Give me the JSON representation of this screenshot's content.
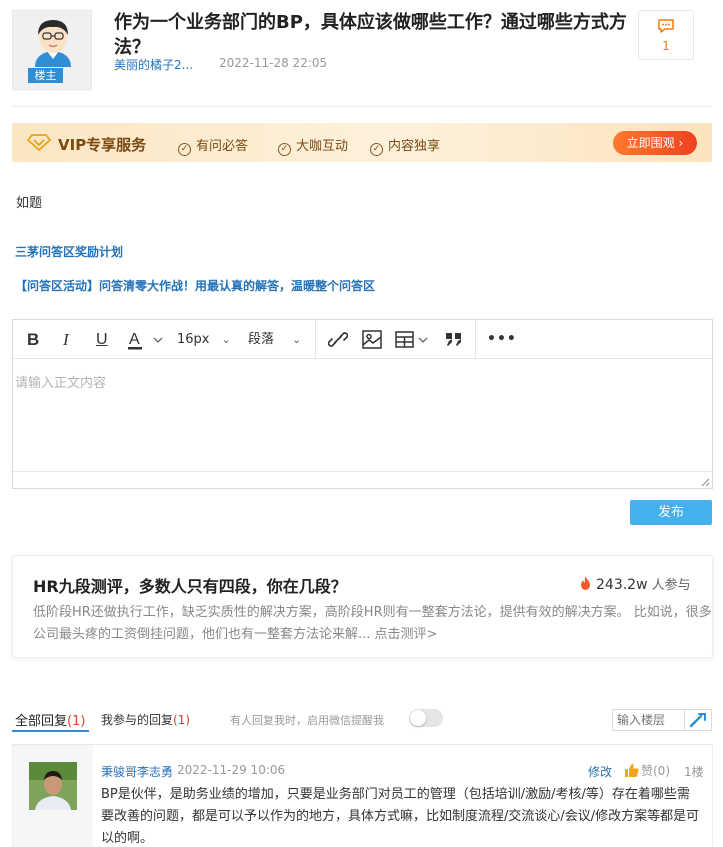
{
  "question": {
    "title": "作为一个业务部门的BP，具体应该做哪些工作？通过哪些方式方法？",
    "host_badge": "楼主",
    "author": "美丽的橘子2...",
    "time": "2022-11-28 22:05",
    "comment_count": "1"
  },
  "vip": {
    "title": "VIP专享服务",
    "features": [
      "有问必答",
      "大咖互动",
      "内容独享"
    ],
    "button": "立即围观"
  },
  "content": {
    "body": "如题",
    "link1": "三茅问答区奖励计划",
    "link2": "【问答区活动】问答清零大作战！用最认真的解答，温暖整个问答区"
  },
  "editor": {
    "font_size": "16px",
    "paragraph": "段落",
    "placeholder": "请输入正文内容",
    "publish": "发布"
  },
  "promo": {
    "title": "HR九段测评，多数人只有四段，你在几段？",
    "count": "243.2w",
    "count_suffix": "人参与",
    "description": "低阶段HR还做执行工作，缺乏实质性的解决方案，高阶段HR则有一整套方法论，提供有效的解决方案。 比如说，很多公司最头疼的工资倒挂问题，他们也有一整套方法论来解... 点击测评>"
  },
  "replies_section": {
    "tab_all": "全部回复",
    "tab_all_count": "(1)",
    "tab_mine": "我参与的回复",
    "tab_mine_count": "(1)",
    "notify_text": "有人回复我时，启用微信提醒我",
    "floor_placeholder": "输入楼层"
  },
  "reply": {
    "author": "秉骏哥李志勇",
    "time": "2022-11-29 10:06",
    "edit": "修改",
    "like": "赞(0)",
    "floor": "1楼",
    "text": "BP是伙伴，是助务业绩的增加，只要是业务部门对员工的管理（包括培训/激励/考核/等）存在着哪些需要改善的问题，都是可以予以作为的地方，具体方式嘛，比如制度流程/交流谈心/会议/修改方案等都是可以的啊。"
  },
  "colors": {
    "link_blue": "#2472b8",
    "vip_button": "#f0411f",
    "publish_button": "#44b0ee",
    "comment_orange": "#f27a0e"
  }
}
